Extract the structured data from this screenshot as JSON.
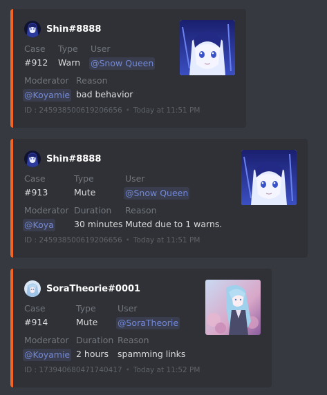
{
  "embeds": [
    {
      "author": "Shin#8888",
      "avatar_icon": "dark-anime-avatar-icon",
      "thumbnail_icon": "anime-girl-blue-hair-thumbnail",
      "fields": {
        "case": {
          "name": "Case",
          "value": "#912"
        },
        "type": {
          "name": "Type",
          "value": "Warn"
        },
        "user": {
          "name": "User",
          "value": "@Snow Queen"
        },
        "moderator": {
          "name": "Moderator",
          "value": "@Koyamie"
        },
        "reason": {
          "name": "Reason",
          "value": "bad behavior"
        }
      },
      "footer_id": "ID : 245938500619206656",
      "footer_time": "Today at 11:51 PM"
    },
    {
      "author": "Shin#8888",
      "avatar_icon": "dark-anime-avatar-icon",
      "thumbnail_icon": "anime-girl-blue-hair-thumbnail",
      "fields": {
        "case": {
          "name": "Case",
          "value": "#913"
        },
        "type": {
          "name": "Type",
          "value": "Mute"
        },
        "user": {
          "name": "User",
          "value": "@Snow Queen"
        },
        "moderator": {
          "name": "Moderator",
          "value": "@Koya"
        },
        "duration": {
          "name": "Duration",
          "value": "30 minutes"
        },
        "reason": {
          "name": "Reason",
          "value": "Muted due to 1 warns."
        }
      },
      "footer_id": "ID : 245938500619206656",
      "footer_time": "Today at 11:51 PM"
    },
    {
      "author": "SoraTheorie#0001",
      "avatar_icon": "light-blue-anime-avatar-icon",
      "thumbnail_icon": "anime-girl-light-blue-hair-thumbnail",
      "fields": {
        "case": {
          "name": "Case",
          "value": "#914"
        },
        "type": {
          "name": "Type",
          "value": "Mute"
        },
        "user": {
          "name": "User",
          "value": "@SoraTheorie"
        },
        "moderator": {
          "name": "Moderator",
          "value": "@Koyamie"
        },
        "duration": {
          "name": "Duration",
          "value": "2 hours"
        },
        "reason": {
          "name": "Reason",
          "value": "spamming links"
        }
      },
      "footer_id": "ID : 173940680471740417",
      "footer_time": "Today at 11:52 PM"
    }
  ],
  "colors": {
    "background": "#36393f",
    "embed_background": "#2f3136",
    "embed_accent": "#f26522",
    "mention": "#7289da",
    "field_name": "#72767d"
  }
}
